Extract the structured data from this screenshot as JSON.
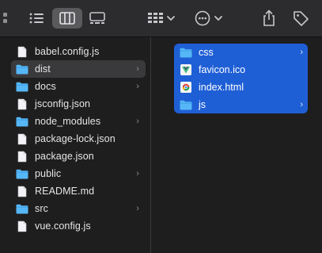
{
  "toolbar": {
    "buttons": [
      {
        "name": "icon-view-icon"
      },
      {
        "name": "list-view-icon"
      },
      {
        "name": "column-view-icon"
      },
      {
        "name": "gallery-view-icon"
      },
      {
        "name": "group-menu-icon"
      },
      {
        "name": "action-menu-icon"
      },
      {
        "name": "share-icon"
      },
      {
        "name": "tag-icon"
      }
    ]
  },
  "column1": {
    "items": [
      {
        "label": "babel.config.js",
        "type": "file"
      },
      {
        "label": "dist",
        "type": "folder",
        "selected": true
      },
      {
        "label": "docs",
        "type": "folder"
      },
      {
        "label": "jsconfig.json",
        "type": "file"
      },
      {
        "label": "node_modules",
        "type": "folder"
      },
      {
        "label": "package-lock.json",
        "type": "file"
      },
      {
        "label": "package.json",
        "type": "file"
      },
      {
        "label": "public",
        "type": "folder"
      },
      {
        "label": "README.md",
        "type": "file"
      },
      {
        "label": "src",
        "type": "folder"
      },
      {
        "label": "vue.config.js",
        "type": "file"
      }
    ]
  },
  "column2": {
    "items": [
      {
        "label": "css",
        "type": "folder"
      },
      {
        "label": "favicon.ico",
        "type": "vue-icon"
      },
      {
        "label": "index.html",
        "type": "chrome-html"
      },
      {
        "label": "js",
        "type": "folder"
      }
    ]
  },
  "colors": {
    "selection": "#1f5fd6",
    "folder": "#56b7f7",
    "background": "#1e1e1e",
    "toolbar": "#2c2c2e"
  }
}
